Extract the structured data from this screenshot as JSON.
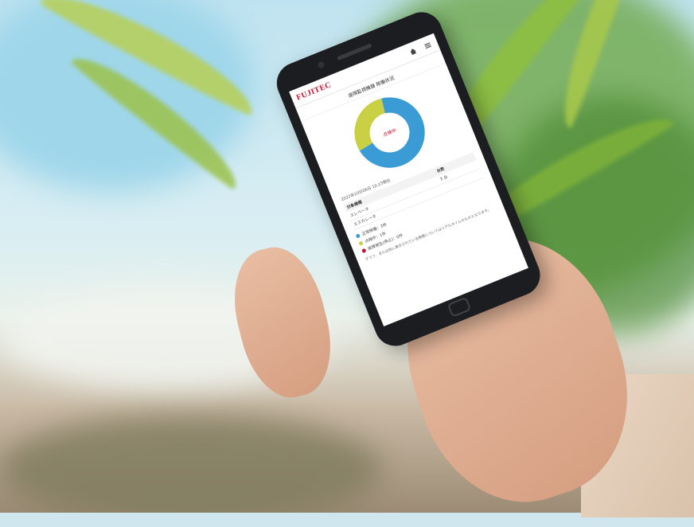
{
  "app": {
    "logo_text": "FUJITEC",
    "title": "遠隔監視機器 稼働状況",
    "icons": [
      "home-icon",
      "menu-icon"
    ]
  },
  "chart_data": {
    "type": "pie",
    "style": "donut",
    "center_label": "点検中",
    "values": [
      70,
      30
    ],
    "colors": [
      "#3a9bd5",
      "#c9d043"
    ]
  },
  "status_info": {
    "datetime": "2022年10月06日 10:15現在"
  },
  "summary_table": {
    "headers": [
      "対象機種",
      "台数"
    ],
    "rows": [
      [
        "エレベータ",
        "3 台"
      ],
      [
        "エスカレータ",
        ""
      ]
    ]
  },
  "legend": [
    {
      "label": "正常稼働：3件",
      "color": "#3a9bd5"
    },
    {
      "label": "点検中：1件",
      "color": "#c9d043"
    },
    {
      "label": "故障発生(停止)：0件",
      "color": "#c8102e"
    }
  ],
  "footnote": "グラフ、または色に表示されている情報についてはリアルタイムのものとなります。"
}
